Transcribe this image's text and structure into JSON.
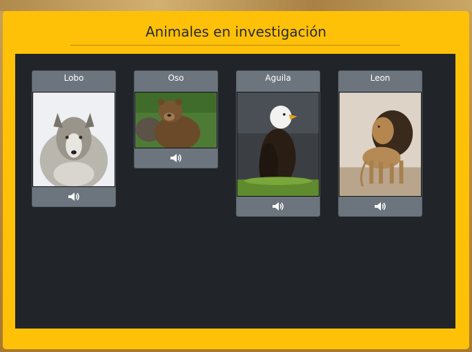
{
  "title": "Animales en investigación",
  "animals": [
    {
      "name": "Lobo",
      "icon": "speaker-icon"
    },
    {
      "name": "Oso",
      "icon": "speaker-icon"
    },
    {
      "name": "Aguila",
      "icon": "speaker-icon"
    },
    {
      "name": "Leon",
      "icon": "speaker-icon"
    }
  ],
  "colors": {
    "panel": "#ffc107",
    "content_bg": "#212529",
    "card_bg": "#6c757d"
  }
}
